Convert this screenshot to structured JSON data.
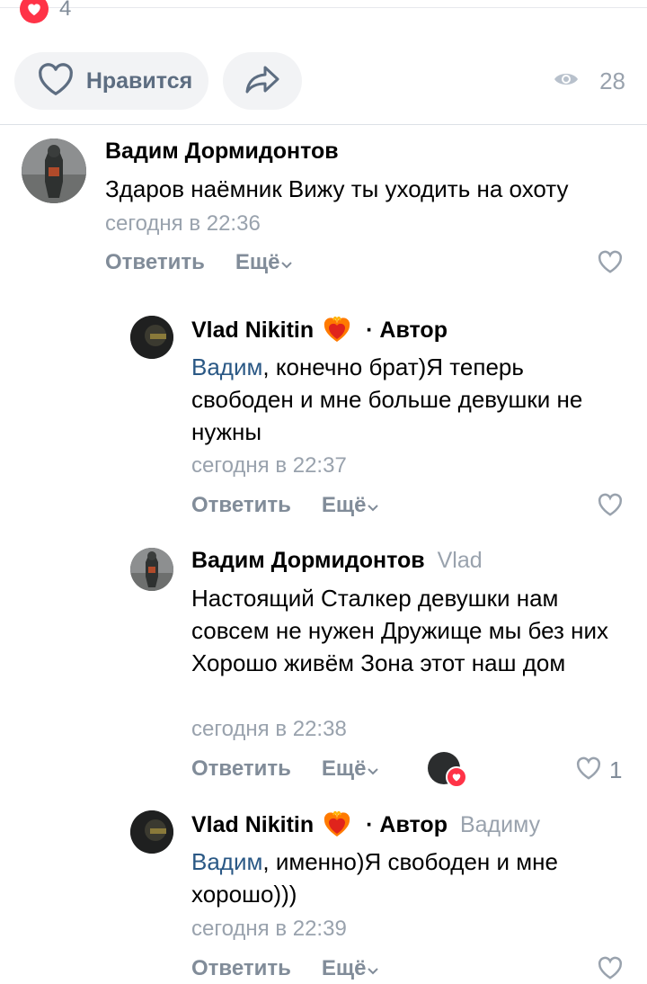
{
  "post": {
    "likes_count": "4",
    "like_label": "Нравится",
    "views": "28"
  },
  "comments": [
    {
      "author": "Вадим Дормидонтов",
      "text": "Здаров наёмник Вижу ты уходить на охоту",
      "date": "сегодня в 22:36",
      "reply_label": "Ответить",
      "more_label": "Ещё"
    },
    {
      "author": "Vlad Nikitin",
      "badge_icon": "fire-heart-icon",
      "tag": "· Автор",
      "mention": "Вадим",
      "text": ", конечно брат)Я теперь свободен и мне больше девушки не нужны",
      "date": "сегодня в 22:37",
      "reply_label": "Ответить",
      "more_label": "Ещё"
    },
    {
      "author": "Вадим Дормидонтов",
      "reply_to": "Vlad",
      "text": "Настоящий Сталкер девушки нам совсем не нужен Дружище мы без них Хорошо живём Зона этот наш дом",
      "date": "сегодня в 22:38",
      "reply_label": "Ответить",
      "more_label": "Ещё",
      "likes": "1"
    },
    {
      "author": "Vlad Nikitin",
      "badge_icon": "fire-heart-icon",
      "tag": "· Автор",
      "reply_to": "Вадиму",
      "mention": "Вадим",
      "text": ", именно)Я свободен и мне хорошо)))",
      "date": "сегодня в 22:39",
      "reply_label": "Ответить",
      "more_label": "Ещё"
    }
  ],
  "colors": {
    "accent_link": "#2a5885",
    "muted": "#99a2ad",
    "like_red": "#ff3347"
  }
}
